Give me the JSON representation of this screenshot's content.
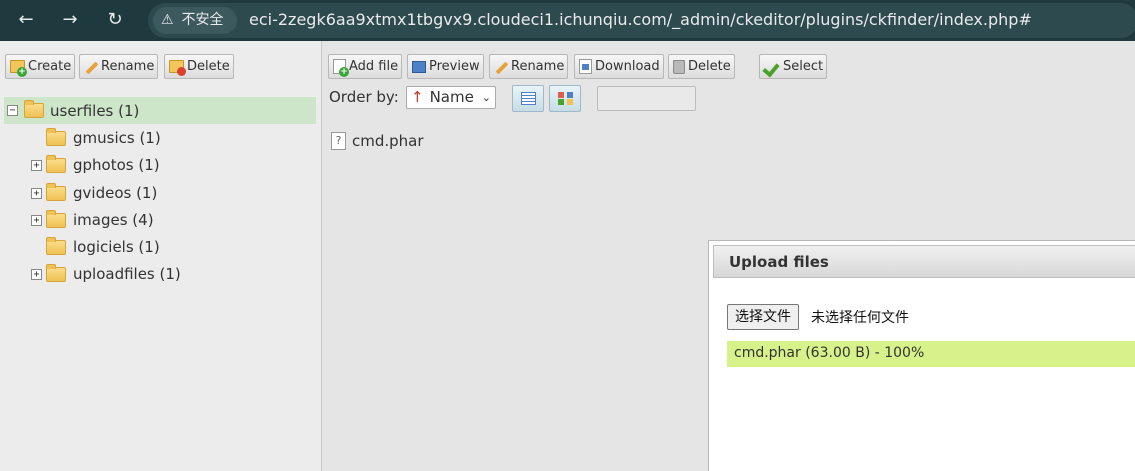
{
  "browser": {
    "back_icon": "←",
    "forward_icon": "→",
    "reload_icon": "↻",
    "security_label": "不安全",
    "url": "eci-2zegk6aa9xtmx1tbgvx9.cloudeci1.ichunqiu.com/_admin/ckeditor/plugins/ckfinder/index.php#"
  },
  "folder_toolbar": {
    "create_label": "Create",
    "rename_label": "Rename",
    "delete_label": "Delete"
  },
  "file_toolbar": {
    "add_file_label": "Add file",
    "preview_label": "Preview",
    "rename_label": "Rename",
    "download_label": "Download",
    "delete_label": "Delete",
    "select_label": "Select"
  },
  "folders": [
    {
      "label": "userfiles (1)",
      "expander": "−"
    },
    {
      "label": "gmusics (1)",
      "expander": ""
    },
    {
      "label": "gphotos (1)",
      "expander": "+"
    },
    {
      "label": "gvideos (1)",
      "expander": "+"
    },
    {
      "label": "images (4)",
      "expander": "+"
    },
    {
      "label": "logiciels (1)",
      "expander": ""
    },
    {
      "label": "uploadfiles (1)",
      "expander": "+"
    }
  ],
  "order_by": {
    "label": "Order by:",
    "arrow": "↑",
    "value": "Name",
    "caret": "⌄"
  },
  "files": [
    {
      "name": "cmd.phar",
      "icon": "?"
    }
  ],
  "upload_dialog": {
    "title": "Upload files",
    "choose_button": "选择文件",
    "no_file_text": "未选择任何文件",
    "progress_text": "cmd.phar (63.00 B) - 100%",
    "progress_fraction": 1.0
  },
  "colors": {
    "browser_bar": "#1f3a3e",
    "selected_folder": "#cde6c9",
    "progress_fill": "#d7f28a"
  }
}
